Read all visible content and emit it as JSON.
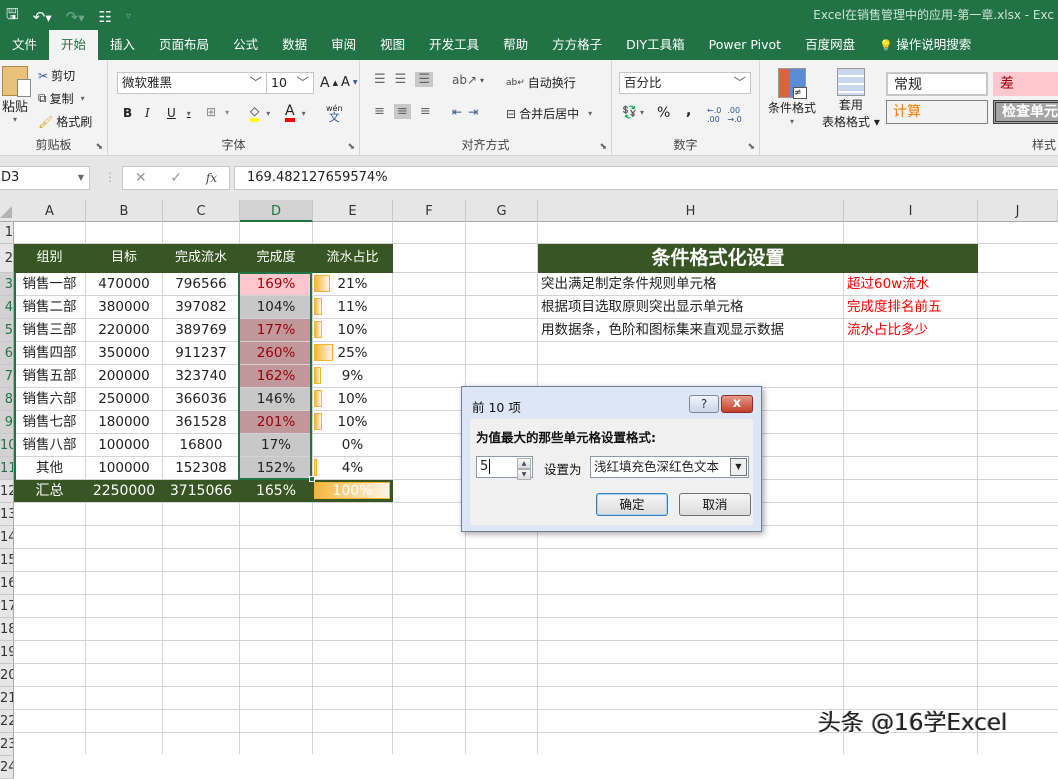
{
  "titlebar": {
    "window_title": "Excel在销售管理中的应用-第一章.xlsx  -  Exc",
    "qat": {
      "save": "save-icon",
      "undo": "undo-icon",
      "redo": "redo-icon",
      "form": "form-icon",
      "customize": "customize-qat-icon"
    }
  },
  "tabs": [
    "文件",
    "开始",
    "插入",
    "页面布局",
    "公式",
    "数据",
    "审阅",
    "视图",
    "开发工具",
    "帮助",
    "方方格子",
    "DIY工具箱",
    "Power Pivot",
    "百度网盘",
    "操作说明搜索"
  ],
  "active_tab": "开始",
  "ribbon": {
    "clipboard": {
      "label": "剪贴板",
      "paste": "粘贴",
      "cut": "剪切",
      "copy": "复制",
      "format_painter": "格式刷"
    },
    "font": {
      "label": "字体",
      "font_name": "微软雅黑",
      "font_size": "10",
      "bold": "B",
      "italic": "I",
      "underline": "U",
      "grow": "A",
      "shrink": "A",
      "phonetic": "wén",
      "fill_color": "#ffff00",
      "font_color": "#ff0000"
    },
    "alignment": {
      "label": "对齐方式",
      "wrap": "自动换行",
      "merge": "合并后居中"
    },
    "number": {
      "label": "数字",
      "format": "百分比",
      "percent": "%",
      "comma": ","
    },
    "styles": {
      "label": "样式",
      "conditional": "条件格式",
      "table_format_1": "套用",
      "table_format_2": "表格格式",
      "normal": "常规",
      "bad": "差",
      "calc": "计算",
      "check": "检查单元"
    }
  },
  "formula_bar": {
    "name_box": "D3",
    "cancel": "✕",
    "enter": "✓",
    "fx": "fx",
    "value": "169.482127659574%"
  },
  "columns": [
    "A",
    "B",
    "C",
    "D",
    "E",
    "F",
    "G",
    "H",
    "I",
    "J"
  ],
  "rows": [
    "1",
    "2",
    "3",
    "4",
    "5",
    "6",
    "7",
    "8",
    "9",
    "10",
    "11",
    "12",
    "13",
    "14",
    "15",
    "16",
    "17",
    "18",
    "19",
    "20",
    "21",
    "22",
    "23",
    "24"
  ],
  "table": {
    "headers": [
      "组别",
      "目标",
      "完成流水",
      "完成度",
      "流水占比"
    ],
    "rows": [
      {
        "group": "销售一部",
        "target": "470000",
        "actual": "796566",
        "rate": "169%",
        "share": "21%",
        "share_value": 0.21,
        "highlight": "light"
      },
      {
        "group": "销售二部",
        "target": "380000",
        "actual": "397082",
        "rate": "104%",
        "share": "11%",
        "share_value": 0.11,
        "highlight": "none"
      },
      {
        "group": "销售三部",
        "target": "220000",
        "actual": "389769",
        "rate": "177%",
        "share": "10%",
        "share_value": 0.1,
        "highlight": "dark"
      },
      {
        "group": "销售四部",
        "target": "350000",
        "actual": "911237",
        "rate": "260%",
        "share": "25%",
        "share_value": 0.25,
        "highlight": "dark"
      },
      {
        "group": "销售五部",
        "target": "200000",
        "actual": "323740",
        "rate": "162%",
        "share": "9%",
        "share_value": 0.09,
        "highlight": "dark"
      },
      {
        "group": "销售六部",
        "target": "250000",
        "actual": "366036",
        "rate": "146%",
        "share": "10%",
        "share_value": 0.1,
        "highlight": "none"
      },
      {
        "group": "销售七部",
        "target": "180000",
        "actual": "361528",
        "rate": "201%",
        "share": "10%",
        "share_value": 0.1,
        "highlight": "dark"
      },
      {
        "group": "销售八部",
        "target": "100000",
        "actual": "16800",
        "rate": "17%",
        "share": "0%",
        "share_value": 0.0,
        "highlight": "none"
      },
      {
        "group": "其他",
        "target": "100000",
        "actual": "152308",
        "rate": "152%",
        "share": "4%",
        "share_value": 0.04,
        "highlight": "none"
      }
    ],
    "total": {
      "group": "汇总",
      "target": "2250000",
      "actual": "3715066",
      "rate": "165%",
      "share": "100%",
      "share_value": 1.0
    }
  },
  "settings_panel": {
    "title": "条件格式化设置",
    "items": [
      {
        "desc": "突出满足制定条件规则单元格",
        "note": "超过60w流水"
      },
      {
        "desc": "根据项目选取原则突出显示单元格",
        "note": "完成度排名前五"
      },
      {
        "desc": "用数据条，色阶和图标集来直观显示数据",
        "note": "流水占比多少"
      }
    ]
  },
  "dialog": {
    "title": "前 10 项",
    "help": "?",
    "close": "x",
    "prompt": "为值最大的那些单元格设置格式:",
    "count": "5",
    "set_as_label": "设置为",
    "format_option": "浅红填充色深红色文本",
    "ok": "确定",
    "cancel": "取消"
  },
  "colors": {
    "excel_green": "#217346",
    "header_green": "#375623",
    "light_red_fill": "#ffc7ce",
    "dark_red_fill": "#c0979b",
    "dark_red_text": "#9c0006",
    "gray_fill": "#c8c8c8",
    "red_note": "#ff0000"
  },
  "watermark": "头条 @16学Excel"
}
